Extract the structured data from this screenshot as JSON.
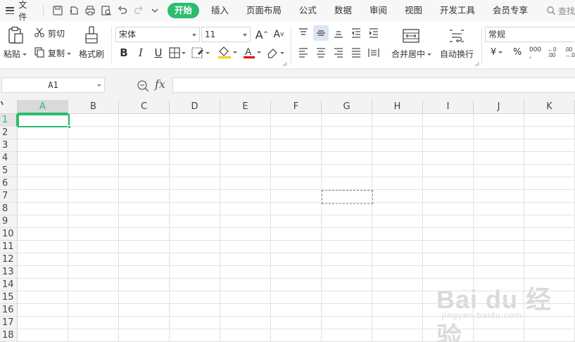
{
  "menu": {
    "file_label": "文件",
    "tabs": [
      "开始",
      "插入",
      "页面布局",
      "公式",
      "数据",
      "审阅",
      "视图",
      "开发工具",
      "会员专享"
    ],
    "active_tab": "开始",
    "search_label": "查找"
  },
  "ribbon": {
    "paste_label": "粘贴",
    "cut_label": "剪切",
    "copy_label": "复制",
    "format_painter_label": "格式刷",
    "font_name": "宋体",
    "font_size": "11",
    "merge_label": "合并居中",
    "wrap_label": "自动换行",
    "number_format": "常规",
    "bold_label": "B",
    "italic_label": "I",
    "underline_label": "U",
    "font_color_label": "A",
    "percent_label": "%",
    "thousands_label": "000",
    "currency_label": "¥",
    "grow_font_label": "A",
    "shrink_font_label": "A",
    "accent_color": "#2bbd6e",
    "font_color_bar": "#e00000",
    "fill_color_bar": "#f5d100"
  },
  "formula_bar": {
    "name_box": "A1",
    "fx_label": "fx",
    "formula_value": ""
  },
  "grid": {
    "columns": [
      "A",
      "B",
      "C",
      "D",
      "E",
      "F",
      "G",
      "H",
      "I",
      "J",
      "K"
    ],
    "rows": [
      "1",
      "2",
      "3",
      "4",
      "5",
      "6",
      "7",
      "8",
      "9",
      "10",
      "11",
      "12",
      "13",
      "14",
      "15",
      "16",
      "17",
      "18"
    ],
    "selected_column": "A",
    "selected_row": "1"
  },
  "watermark": {
    "text": "Bai du 经验",
    "url": "jingyan.baidu.com"
  }
}
